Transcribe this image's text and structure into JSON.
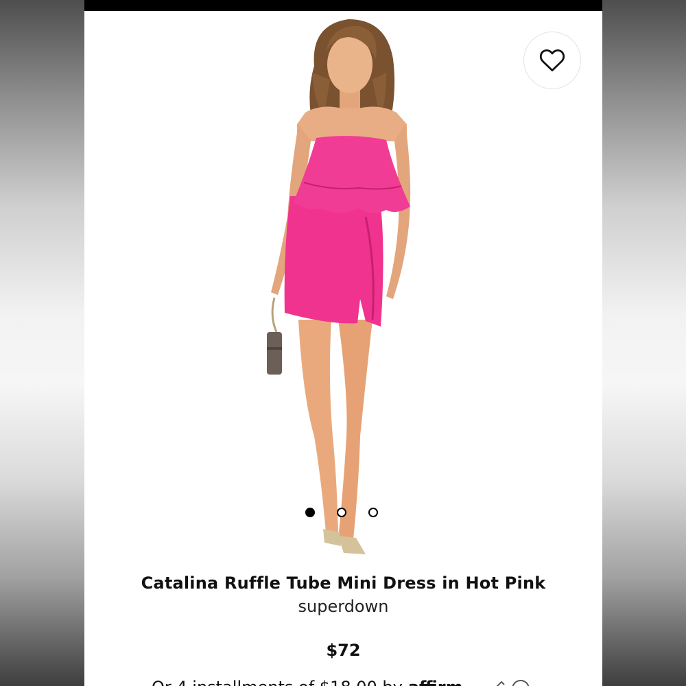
{
  "product": {
    "title": "Catalina Ruffle Tube Mini Dress in Hot Pink",
    "brand": "superdown",
    "price": "$72",
    "installment_text": "Or 4 installments of $18.00 by",
    "installment_provider": "affirm"
  },
  "carousel": {
    "total": 3,
    "active_index": 0
  },
  "colors": {
    "dress": "#f0338e",
    "dress_shadow": "#c81f6f",
    "skin": "#e8ad84",
    "hair": "#7a5230"
  },
  "icons": {
    "favorite": "heart-outline-icon"
  }
}
